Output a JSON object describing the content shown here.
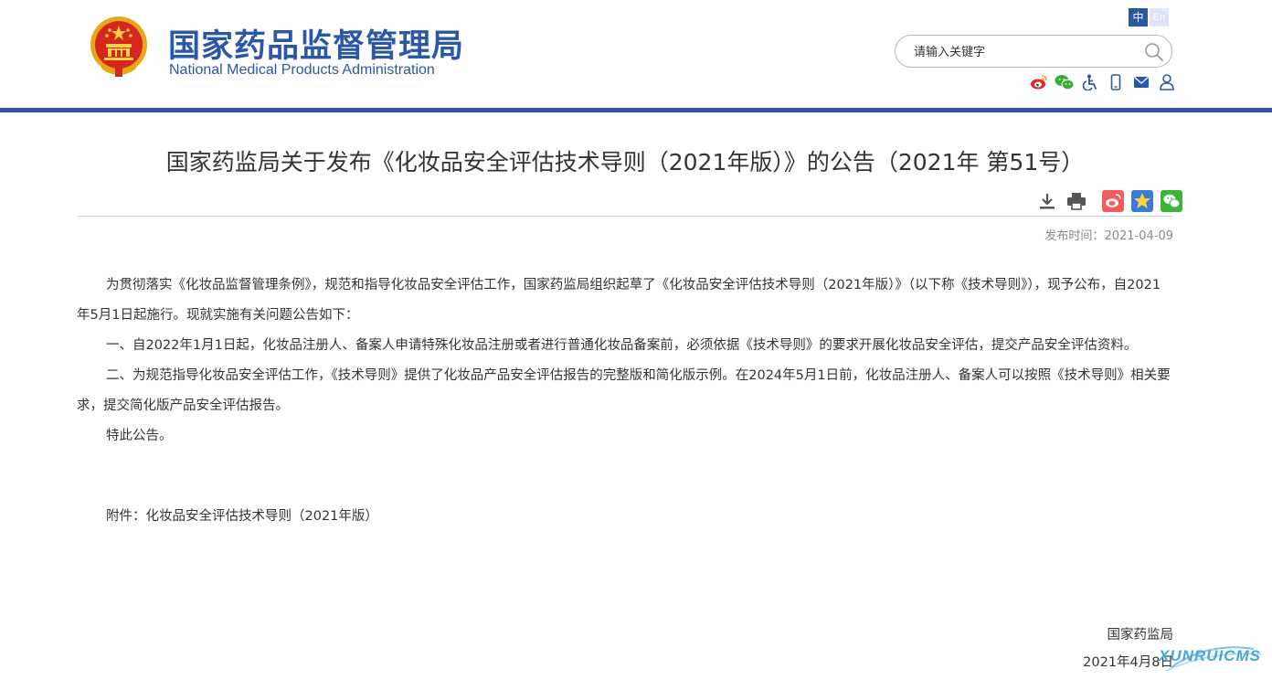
{
  "header": {
    "site_name_cn": "国家药品监督管理局",
    "site_name_en": "National Medical Products Administration",
    "lang_cn": "中",
    "lang_en": "En",
    "search_placeholder": "请输入关键字",
    "tool_icons": [
      "weibo-icon",
      "wechat-icon",
      "accessibility-icon",
      "mobile-icon",
      "mail-icon",
      "user-icon"
    ],
    "brand_color": "#2a58a6"
  },
  "article": {
    "title": "国家药监局关于发布《化妆品安全评估技术导则（2021年版）》的公告（2021年 第51号）",
    "share_icons": [
      "download-icon",
      "print-icon",
      "weibo-share-icon",
      "favorite-star-icon",
      "wechat-share-icon"
    ],
    "pubtime_label": "发布时间：",
    "pubtime_value": "2021-04-09",
    "paragraphs": [
      "为贯彻落实《化妆品监督管理条例》，规范和指导化妆品安全评估工作，国家药监局组织起草了《化妆品安全评估技术导则（2021年版）》（以下称《技术导则》），现予公布，自2021年5月1日起施行。现就实施有关问题公告如下：",
      "一、自2022年1月1日起，化妆品注册人、备案人申请特殊化妆品注册或者进行普通化妆品备案前，必须依据《技术导则》的要求开展化妆品安全评估，提交产品安全评估资料。",
      "二、为规范指导化妆品安全评估工作，《技术导则》提供了化妆品产品安全评估报告的完整版和简化版示例。在2024年5月1日前，化妆品注册人、备案人可以按照《技术导则》相关要求，提交简化版产品安全评估报告。",
      "特此公告。"
    ],
    "attachment_label": "附件：",
    "attachment_link": "化妆品安全评估技术导则（2021年版）",
    "signer": "国家药监局",
    "sign_date": "2021年4月8日"
  },
  "watermark": {
    "text": "XUNRUICMS"
  }
}
